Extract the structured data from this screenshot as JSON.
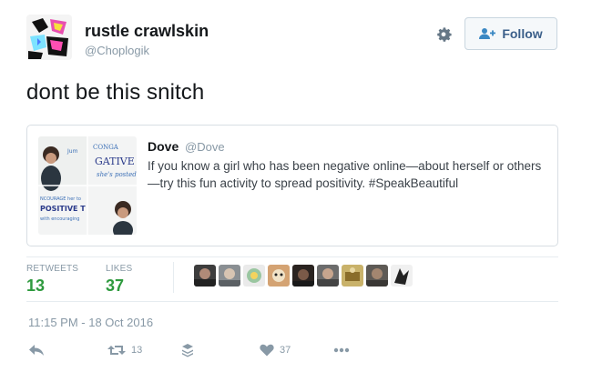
{
  "author": {
    "name": "rustle crawlskin",
    "handle": "@Choplogik"
  },
  "header": {
    "follow_label": "Follow",
    "settings_icon": "gear-icon"
  },
  "tweet": {
    "text": "dont be this snitch",
    "timestamp": "11:15 PM - 18 Oct 2016"
  },
  "quoted": {
    "name": "Dove",
    "handle": "@Dove",
    "text": "If you know a girl who has been negative online—about herself or others—try this fun activity to spread positivity. #SpeakBeautiful",
    "media_words": [
      "CONGA",
      "GATIVE TWE",
      "POSITIVE T"
    ]
  },
  "stats": {
    "retweets_label": "RETWEETS",
    "retweets": "13",
    "likes_label": "LIKES",
    "likes": "37"
  },
  "actions": {
    "retweet_count": "13",
    "like_count": "37"
  },
  "colors": {
    "accent_green": "#2e9a3e",
    "muted": "#8899a6",
    "follow_text": "#3b5f8a"
  }
}
